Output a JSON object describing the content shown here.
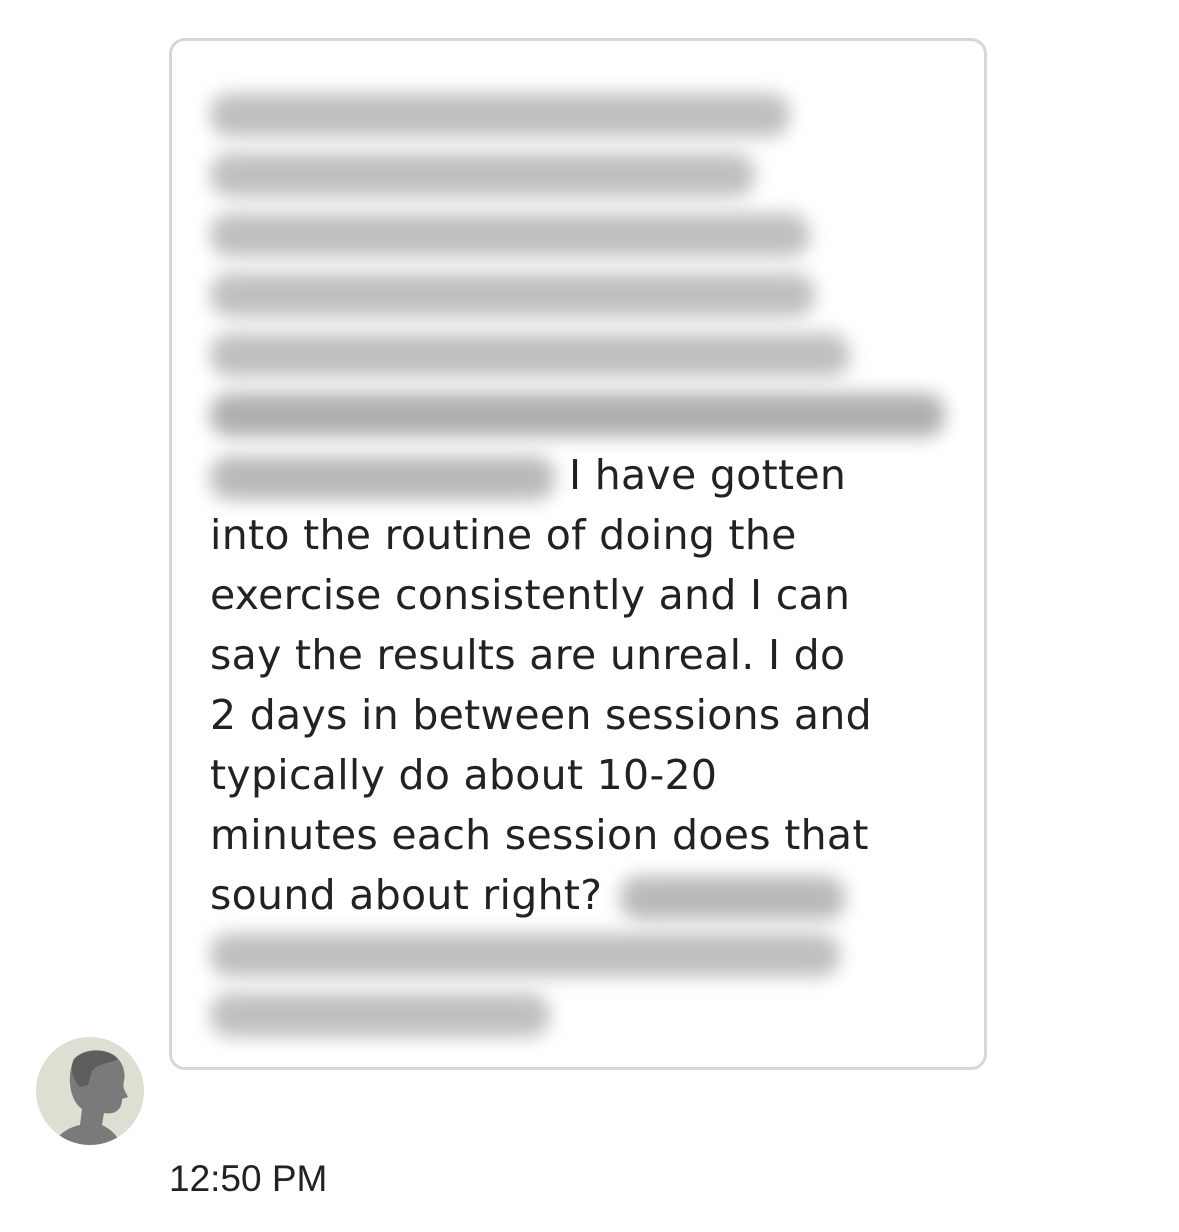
{
  "message": {
    "lines": [
      "I have gotten",
      "into the routine of doing the",
      "exercise consistently and I can",
      "say the results are unreal. I do",
      "2 days in between sessions and",
      "typically do about 10-20",
      "minutes each session does that",
      "sound about right?"
    ]
  },
  "timestamp": "12:50 PM",
  "avatar_icon": "person-silhouette-icon"
}
